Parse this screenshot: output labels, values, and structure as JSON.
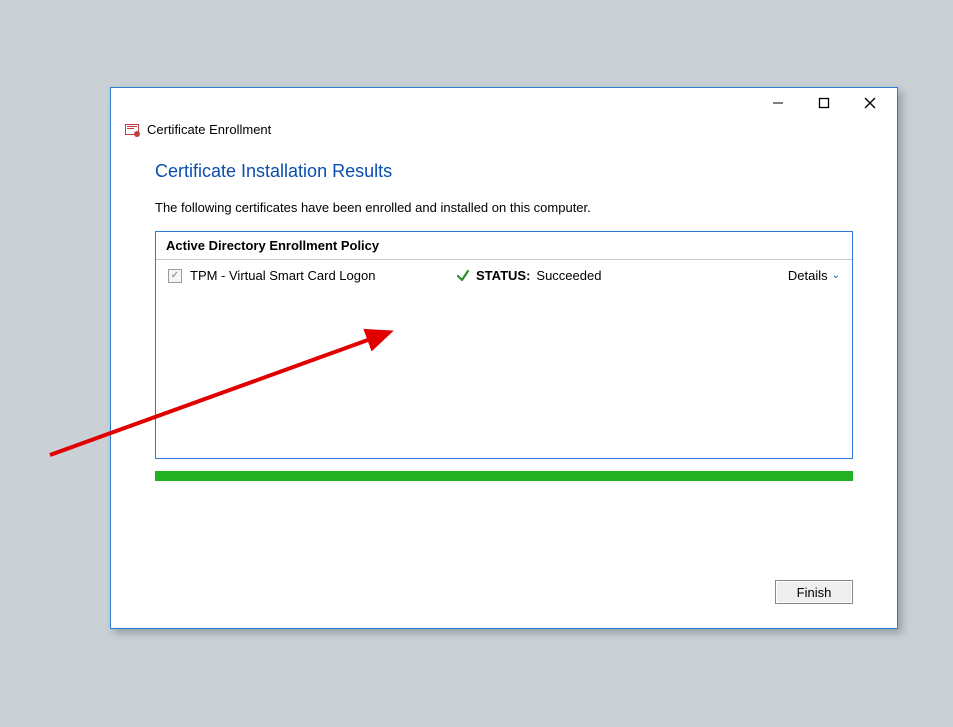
{
  "window": {
    "app_title": "Certificate Enrollment"
  },
  "page": {
    "heading": "Certificate Installation Results",
    "description": "The following certificates have been enrolled and installed on this computer."
  },
  "policy": {
    "title": "Active Directory Enrollment Policy",
    "items": [
      {
        "checked": true,
        "name": "TPM - Virtual Smart Card Logon",
        "status_label": "STATUS:",
        "status_value": "Succeeded",
        "details_label": "Details"
      }
    ]
  },
  "progress": {
    "percent": 100,
    "color": "#22b122"
  },
  "buttons": {
    "finish": "Finish"
  }
}
